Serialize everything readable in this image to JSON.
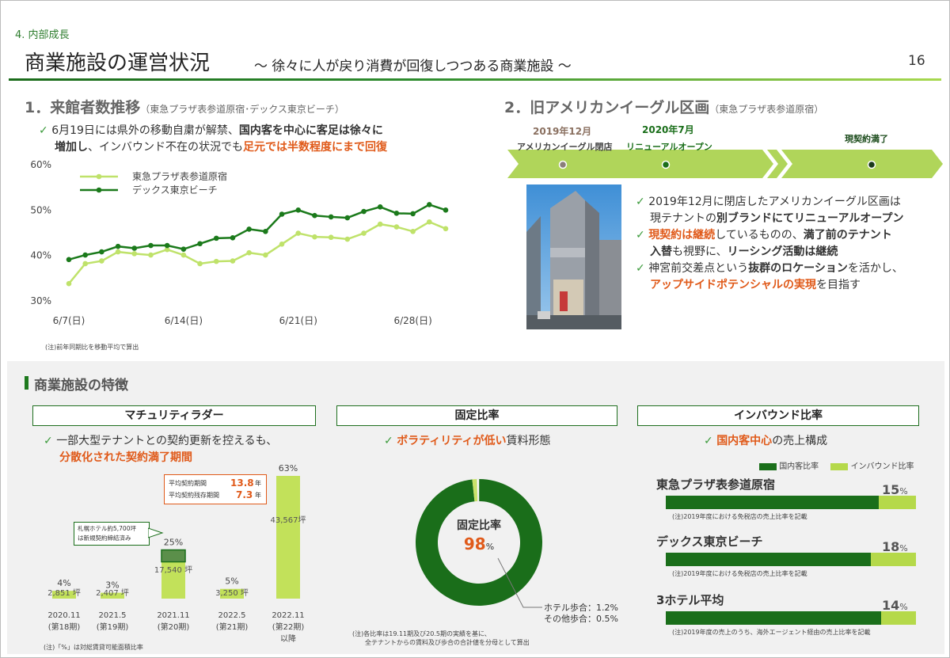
{
  "header": {
    "section": "4. 内部成長",
    "title": "商業施設の運営状況",
    "subtitle": "～ 徐々に人が戻り消費が回復しつつある商業施設 ～",
    "page": "16"
  },
  "visitors": {
    "title": "1．来館者数推移",
    "title_sub": "（東急プラザ表参道原宿･デックス東京ビーチ）",
    "b1_a": "6月19日には県外の移動自粛が解禁、",
    "b1_b": "国内客を中心に客足は徐々に",
    "b1_c": "増加し",
    "b1_d": "、インバウンド不在の状況でも",
    "b1_e": "足元では半数程度にまで回復",
    "note": "(注)前年同期比を移動平均で算出"
  },
  "eagle": {
    "title": "2．旧アメリカンイーグル区画",
    "title_sub": "（東急プラザ表参道原宿）",
    "tl1_date": "2019年12月",
    "tl1_label": "アメリカンイーグル閉店",
    "tl2_date": "2020年7月",
    "tl2_label": "リニューアルオープン",
    "tl3_label": "現契約満了",
    "b1_a": "2019年12月に閉店したアメリカンイーグル区画は",
    "b1_b": "現テナントの",
    "b1_c": "別ブランドにてリニューアルオープン",
    "b2_a": "現契約は継続",
    "b2_b": "しているものの、",
    "b2_c": "満了前のテナント",
    "b2_d": "入替",
    "b2_e": "も視野に、",
    "b2_f": "リーシング活動は継続",
    "b3_a": "神宮前交差点という",
    "b3_b": "抜群のロケーション",
    "b3_c": "を活かし、",
    "b3_d": "アップサイドポテンシャルの実現",
    "b3_e": "を目指す"
  },
  "features": {
    "title": "商業施設の特徴",
    "maturity": {
      "header": "マチュリティラダー",
      "b_a": "一部大型テナントとの契約更新を控えるも、",
      "b_b": "分散化された契約満了期間",
      "avg1_label": "平均契約期間",
      "avg1_value": "13.8",
      "avg1_unit": "年",
      "avg2_label": "平均契約残存期間",
      "avg2_value": "7.3",
      "avg2_unit": "年",
      "callout1": "札幌ホテル約5,700坪",
      "callout2": "は新規契約締結済み",
      "note": "(注)「%」は対総賃貸可能面積比率"
    },
    "fixed": {
      "header": "固定比率",
      "b_a": "ボラティリティが低い",
      "b_b": "賃料形態",
      "center_label": "固定比率",
      "center_value": "98",
      "center_unit": "%",
      "leg1": "ホテル歩合：1.2%",
      "leg2": "その他歩合：0.5%",
      "note1": "(注)各比率は19.11期及び20.5期の実績を基に、",
      "note2": "全テナントからの賃料及び歩合の合計値を分母として算出"
    },
    "inbound": {
      "header": "インバウンド比率",
      "b_a": "国内客中心",
      "b_b": "の売上構成",
      "leg_domestic": "国内客比率",
      "leg_inbound": "インバウンド比率",
      "rows": [
        {
          "name": "東急プラザ表参道原宿",
          "pct": "15",
          "unit": "%",
          "note": "(注)2019年度における免税店の売上比率を記載"
        },
        {
          "name": "デックス東京ビーチ",
          "pct": "18",
          "unit": "%",
          "note": "(注)2019年度における免税店の売上比率を記載"
        },
        {
          "name": "3ホテル平均",
          "pct": "14",
          "unit": "%",
          "note": "(注)2019年度の売上のうち、海外エージェント経由の売上比率を記載"
        }
      ]
    }
  },
  "colors": {
    "dark_green": "#1a6e1a",
    "light_green": "#b5d94a",
    "orange": "#e05a1a"
  },
  "chart_data": [
    {
      "type": "line",
      "title": "",
      "ylim": [
        30,
        60
      ],
      "yticks": [
        "60%",
        "50%",
        "40%",
        "30%"
      ],
      "ytick_values": [
        60,
        50,
        40,
        30
      ],
      "xticks": [
        "6/7(日)",
        "6/14(日)",
        "6/21(日)",
        "6/28(日)"
      ],
      "xtick_index": [
        0,
        7,
        14,
        21
      ],
      "series": [
        {
          "name": "東急プラザ表参道原宿",
          "color": "#bfe26a",
          "values": [
            33.8,
            38.2,
            38.8,
            40.8,
            40.4,
            40.1,
            41.3,
            40.1,
            38.2,
            38.7,
            38.8,
            40.6,
            40.1,
            42.5,
            44.9,
            44.1,
            44.0,
            43.6,
            44.9,
            46.9,
            46.3,
            45.3,
            47.4,
            45.9
          ]
        },
        {
          "name": "デックス東京ビーチ",
          "color": "#1b7a1b",
          "values": [
            39.1,
            40.1,
            40.8,
            42.0,
            41.6,
            42.2,
            42.2,
            41.4,
            42.6,
            43.8,
            43.9,
            45.8,
            45.3,
            49.1,
            50.0,
            48.8,
            48.5,
            48.3,
            49.7,
            50.7,
            49.3,
            49.2,
            51.2,
            50.0
          ]
        }
      ]
    },
    {
      "type": "bar",
      "title": "",
      "categories": [
        "2020.11\n(第18期)",
        "2021.5\n(第19期)",
        "2021.11\n(第20期)",
        "2022.5\n(第21期)",
        "2022.11\n(第22期)\n以降"
      ],
      "cat_lines": [
        [
          "2020.11",
          "(第18期)"
        ],
        [
          "2021.5",
          "(第19期)"
        ],
        [
          "2021.11",
          "(第20期)"
        ],
        [
          "2022.5",
          "(第21期)"
        ],
        [
          "2022.11",
          "(第22期)",
          "以降"
        ]
      ],
      "percents": [
        "4%",
        "3%",
        "25%",
        "5%",
        "63%"
      ],
      "values": [
        2851,
        2407,
        17540,
        3250,
        43567
      ],
      "value_labels": [
        "2,851 坪",
        "2,407 坪",
        "17,540 坪",
        "3,250 坪",
        "43,567坪"
      ],
      "pct_values": [
        4,
        3,
        25,
        5,
        63
      ],
      "extra_value": 5700
    },
    {
      "type": "pie",
      "title": "",
      "slices": [
        {
          "name": "固定比率",
          "value": 98.3,
          "color": "#1a6e1a"
        },
        {
          "name": "ホテル歩合",
          "value": 1.2,
          "color": "#c9e26a"
        },
        {
          "name": "その他歩合",
          "value": 0.5,
          "color": "#ffffff"
        }
      ]
    },
    {
      "type": "bar",
      "orientation": "horizontal",
      "stacked": true,
      "categories": [
        "東急プラザ表参道原宿",
        "デックス東京ビーチ",
        "3ホテル平均"
      ],
      "series": [
        {
          "name": "国内客比率",
          "values": [
            85,
            82,
            86
          ]
        },
        {
          "name": "インバウンド比率",
          "values": [
            15,
            18,
            14
          ]
        }
      ]
    }
  ]
}
